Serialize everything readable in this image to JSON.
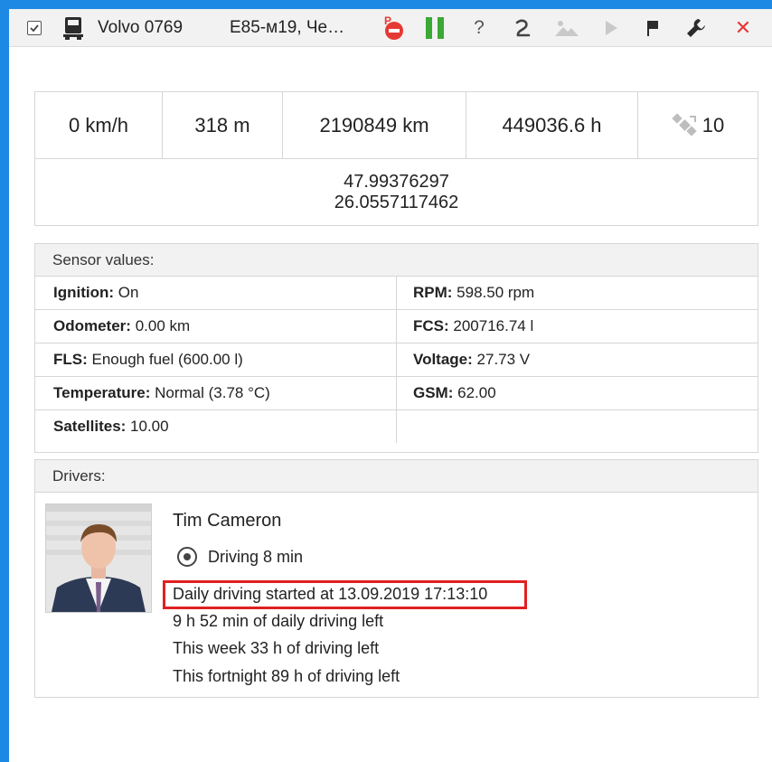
{
  "toolbar": {
    "unit_name": "Volvo 0769",
    "address": "E85-м19, Че…",
    "icons": [
      "checkbox-icon",
      "truck-icon",
      "parking-forbidden-icon",
      "pause-icon",
      "help-icon",
      "track-icon",
      "photo-icon",
      "play-icon",
      "flag-icon",
      "wrench-icon",
      "close-icon"
    ],
    "help_glyph": "?",
    "close_glyph": "✕"
  },
  "stats": {
    "speed": "0 km/h",
    "altitude": "318 m",
    "mileage": "2190849 km",
    "engine_hours": "449036.6 h",
    "satellites": "10"
  },
  "coordinates": {
    "lat": "47.99376297",
    "lon": "26.0557117462"
  },
  "sensors": {
    "title": "Sensor values:",
    "rows": [
      {
        "left_label": "Ignition:",
        "left_value": " On",
        "right_label": "RPM:",
        "right_value": " 598.50 rpm"
      },
      {
        "left_label": "Odometer:",
        "left_value": " 0.00 km",
        "right_label": "FCS:",
        "right_value": " 200716.74 l"
      },
      {
        "left_label": "FLS:",
        "left_value": " Enough fuel (600.00 l)",
        "right_label": "Voltage:",
        "right_value": " 27.73 V"
      },
      {
        "left_label": "Temperature:",
        "left_value": " Normal (3.78 °C)",
        "right_label": "GSM:",
        "right_value": " 62.00"
      },
      {
        "left_label": "Satellites:",
        "left_value": " 10.00",
        "right_label": "",
        "right_value": ""
      }
    ]
  },
  "drivers": {
    "title": "Drivers:",
    "name": "Tim Cameron",
    "status": "Driving 8 min",
    "daily_started": "Daily driving started at 13.09.2019 17:13:10",
    "daily_left": "9 h 52 min of daily driving left",
    "week_left": "This week 33 h of driving left",
    "fortnight_left": "This fortnight 89 h of driving left"
  },
  "colors": {
    "frame": "#1e88e5",
    "highlight": "#e02020",
    "pause": "#3aa935",
    "close": "#e53935",
    "parking": "#e53935"
  }
}
